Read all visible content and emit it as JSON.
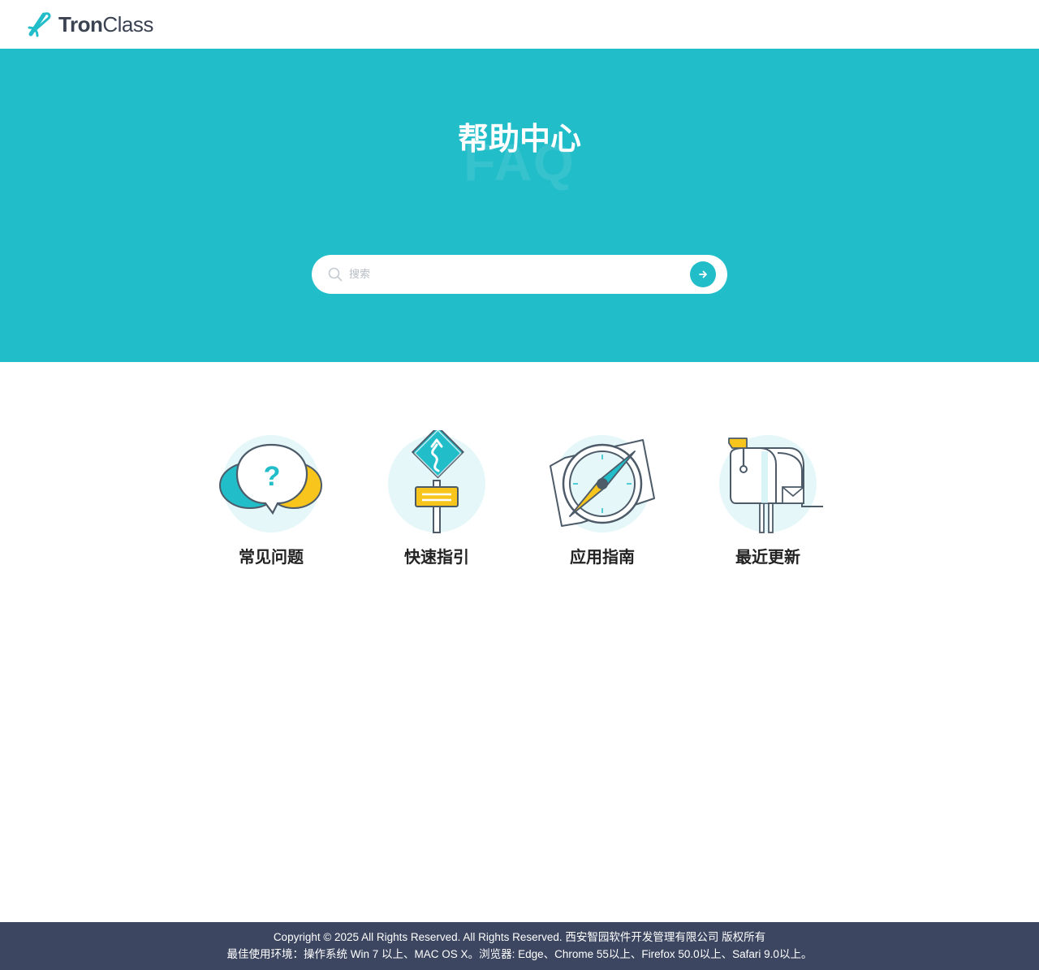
{
  "header": {
    "logo": {
      "text_bold": "Tron",
      "text_regular": "Class",
      "icon": "tronclass-logo-icon"
    }
  },
  "hero": {
    "title": "帮助中心",
    "subtitle_watermark": "FAQ",
    "background_color": "#21bdc9"
  },
  "search": {
    "placeholder": "搜索",
    "icon": "search-icon",
    "submit_icon": "arrow-right-icon"
  },
  "categories": [
    {
      "label": "常见问题",
      "icon": "speech-bubbles-question-icon"
    },
    {
      "label": "快速指引",
      "icon": "road-sign-icon"
    },
    {
      "label": "应用指南",
      "icon": "compass-map-icon"
    },
    {
      "label": "最近更新",
      "icon": "mailbox-icon"
    }
  ],
  "footer": {
    "copyright": "Copyright © 2025 All Rights Reserved. All Rights Reserved. 西安智园软件开发管理有限公司 版权所有",
    "environment": "最佳使用环境：操作系统 Win 7 以上、MAC OS X。浏览器: Edge、Chrome 55以上、Firefox 50.0以上、Safari 9.0以上。",
    "background_color": "#3c4660"
  },
  "colors": {
    "accent": "#21bdc9",
    "yellow": "#f7c51c",
    "outline": "#4d5b69"
  }
}
